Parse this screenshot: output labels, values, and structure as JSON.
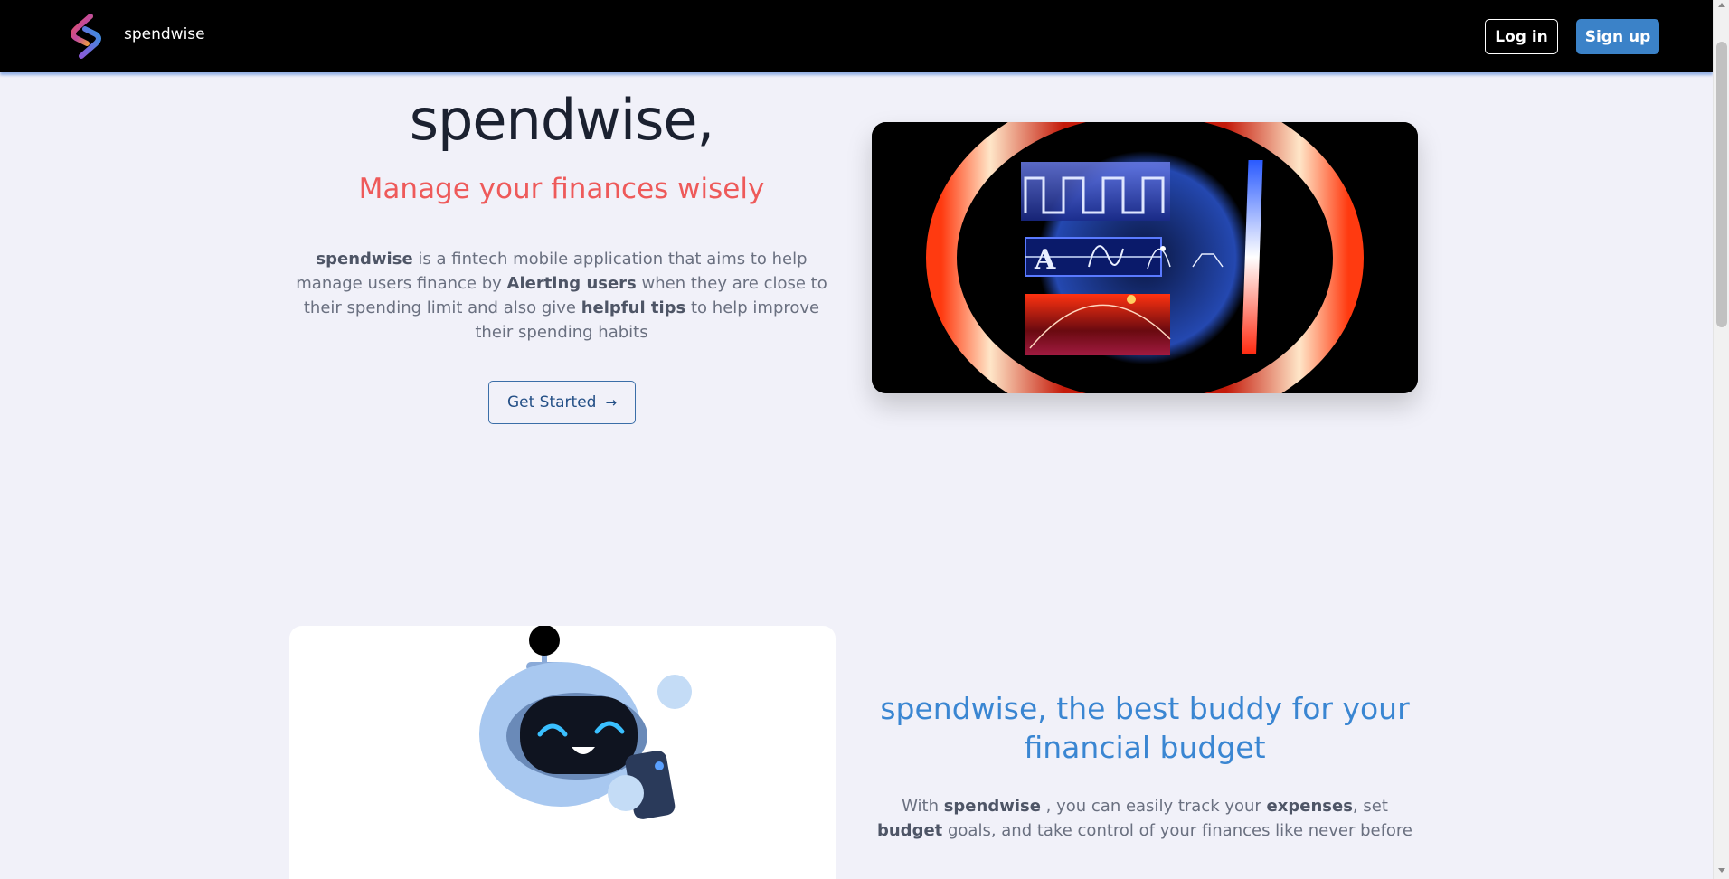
{
  "nav": {
    "brand": "spendwise",
    "login_label": "Log in",
    "signup_label": "Sign up"
  },
  "hero": {
    "title": "spendwise,",
    "subtitle": "Manage your finances wisely",
    "desc": {
      "b1": "spendwise",
      "t1": " is a fintech mobile application that aims to help manage users finance by ",
      "b2": "Alerting users",
      "t2": " when they are close to their spending limit and also give ",
      "b3": "helpful tips",
      "t3": " to help improve their spending habits"
    },
    "cta_label": "Get Started",
    "cta_icon": "arrow-right-icon"
  },
  "section2": {
    "title": "spendwise, the best buddy for your financial budget",
    "desc": {
      "t0": "With ",
      "b1": "spendwise",
      "t1": " , you can easily track your ",
      "b2": "expenses",
      "t2": ", set ",
      "b3": "budget",
      "t3": " goals, and take control of your finances like never before"
    }
  },
  "colors": {
    "navbar_bg": "#000000",
    "accent_blue": "#3b82c8",
    "subtitle_red": "#ee5a5a",
    "page_bg": "#f1f1f9"
  }
}
